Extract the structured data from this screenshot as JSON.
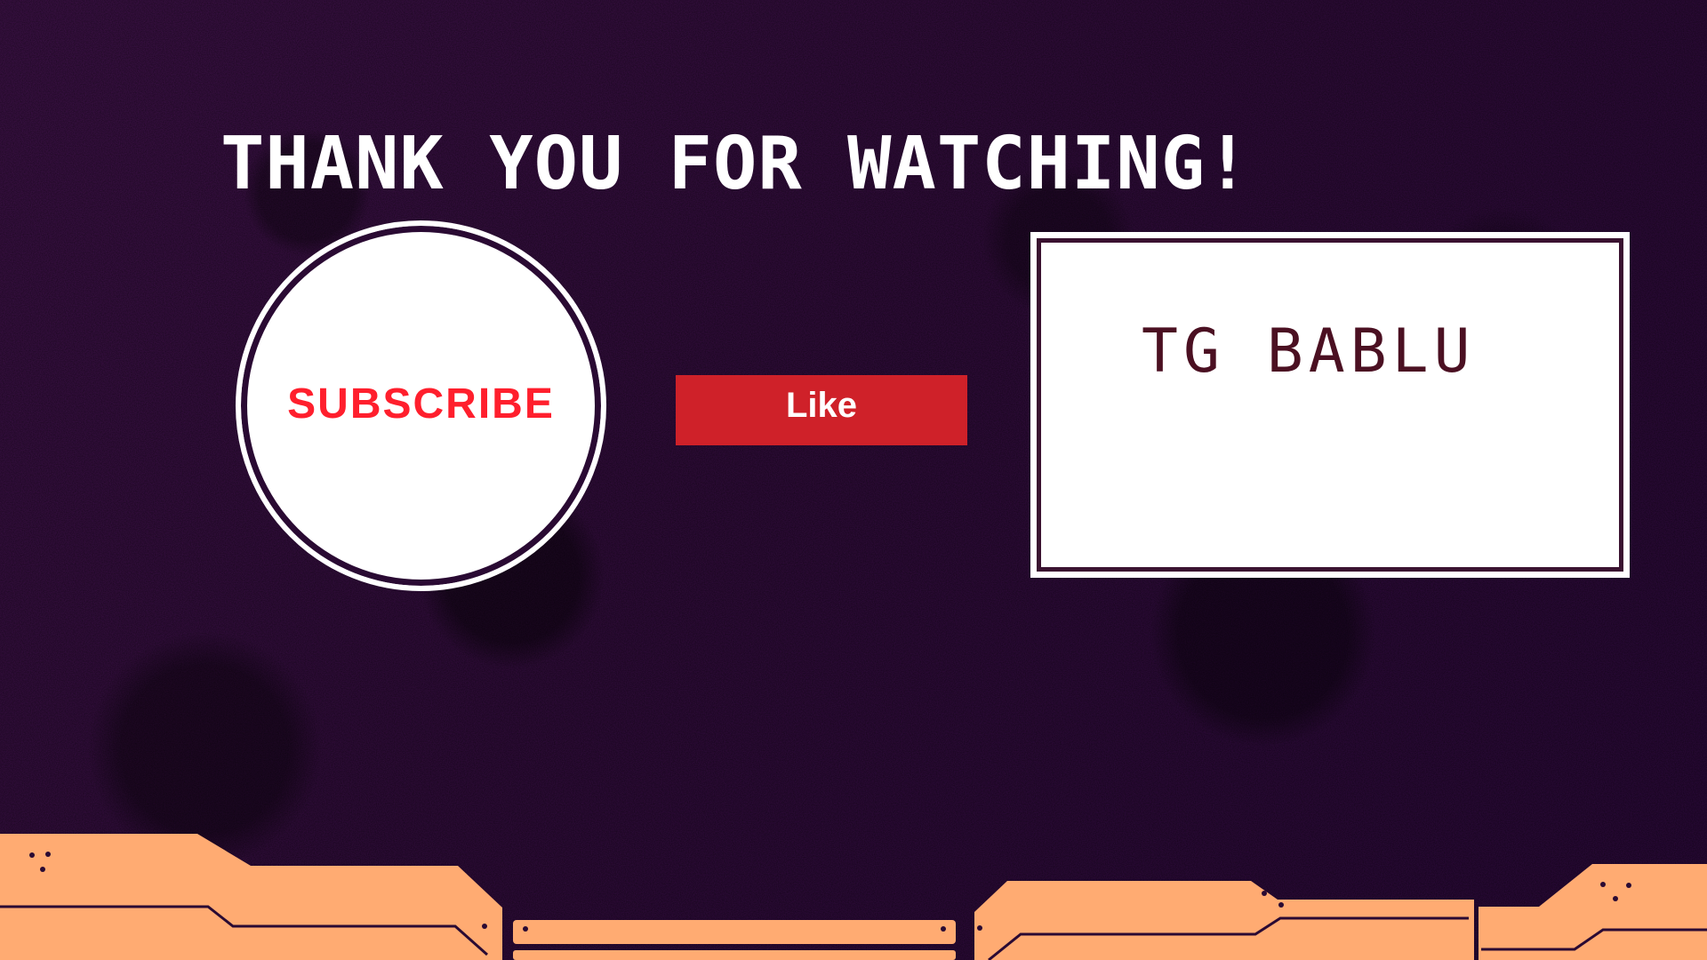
{
  "title": "THANK YOU FOR WATCHING!",
  "subscribe": {
    "label": "SUBSCRIBE",
    "label_color": "#ff1f2d"
  },
  "like": {
    "label": "Like",
    "button_color": "#cf2129"
  },
  "name_card": {
    "label": "TG BABLU",
    "text_color": "#4b1022"
  },
  "colors": {
    "background": "#2a0a33",
    "accent_orange": "#ffab72",
    "outline": "#2a0a33"
  }
}
